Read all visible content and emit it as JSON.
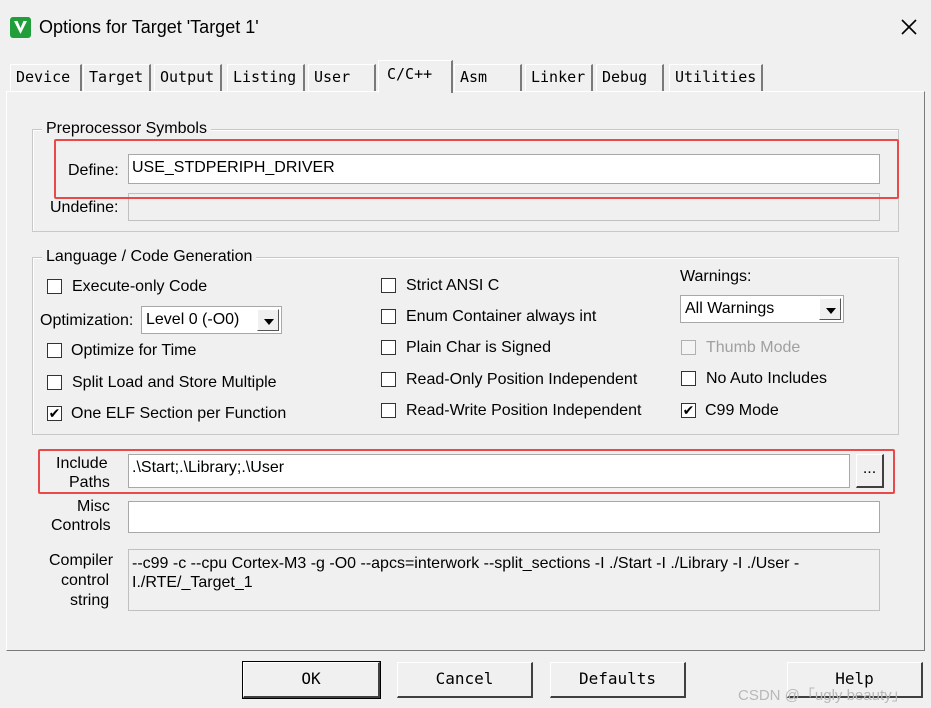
{
  "window": {
    "title": "Options for Target 'Target 1'",
    "icon": "keil-uvision-icon"
  },
  "tabs": [
    {
      "label": "Device"
    },
    {
      "label": "Target"
    },
    {
      "label": "Output"
    },
    {
      "label": "Listing"
    },
    {
      "label": "User"
    },
    {
      "label": "C/C++"
    },
    {
      "label": "Asm"
    },
    {
      "label": "Linker"
    },
    {
      "label": "Debug"
    },
    {
      "label": "Utilities"
    }
  ],
  "active_tab": "C/C++",
  "preprocessor": {
    "title": "Preprocessor Symbols",
    "define_label": "Define:",
    "define_value": "USE_STDPERIPH_DRIVER",
    "undefine_label": "Undefine:",
    "undefine_value": ""
  },
  "language": {
    "title": "Language / Code Generation",
    "execute_only": {
      "label": "Execute-only Code",
      "checked": false
    },
    "optimization_label": "Optimization:",
    "optimization_value": "Level 0 (-O0)",
    "optimize_time": {
      "label": "Optimize for Time",
      "checked": false
    },
    "split_load": {
      "label": "Split Load and Store Multiple",
      "checked": false
    },
    "one_elf": {
      "label": "One ELF Section per Function",
      "checked": true,
      "mark": "✔"
    },
    "strict_ansi": {
      "label": "Strict ANSI C",
      "checked": false
    },
    "enum_container": {
      "label": "Enum Container always int",
      "checked": false
    },
    "plain_char": {
      "label": "Plain Char is Signed",
      "checked": false
    },
    "ro_position": {
      "label": "Read-Only Position Independent",
      "checked": false
    },
    "rw_position": {
      "label": "Read-Write Position Independent",
      "checked": false
    },
    "warnings_label": "Warnings:",
    "warnings_value": "All Warnings",
    "thumb_mode": {
      "label": "Thumb Mode",
      "checked": false,
      "disabled": true
    },
    "no_auto_includes": {
      "label": "No Auto Includes",
      "checked": false
    },
    "c99_mode": {
      "label": "C99 Mode",
      "checked": true,
      "mark": "✔"
    }
  },
  "include": {
    "label_line1": "Include",
    "label_line2": "Paths",
    "value": ".\\Start;.\\Library;.\\User",
    "browse_label": "..."
  },
  "misc": {
    "label_line1": "Misc",
    "label_line2": "Controls",
    "value": ""
  },
  "compiler": {
    "label_line1": "Compiler",
    "label_line2": "control",
    "label_line3": "string",
    "value": "--c99 -c --cpu Cortex-M3 -g -O0 --apcs=interwork --split_sections -I ./Start -I ./Library -I ./User -I./RTE/_Target_1"
  },
  "buttons": {
    "ok": "OK",
    "cancel": "Cancel",
    "defaults": "Defaults",
    "help": "Help"
  },
  "watermark": "CSDN @「ugly beauty」",
  "colors": {
    "highlight": "#e84a4a",
    "icon_green": "#1f9e3a"
  }
}
